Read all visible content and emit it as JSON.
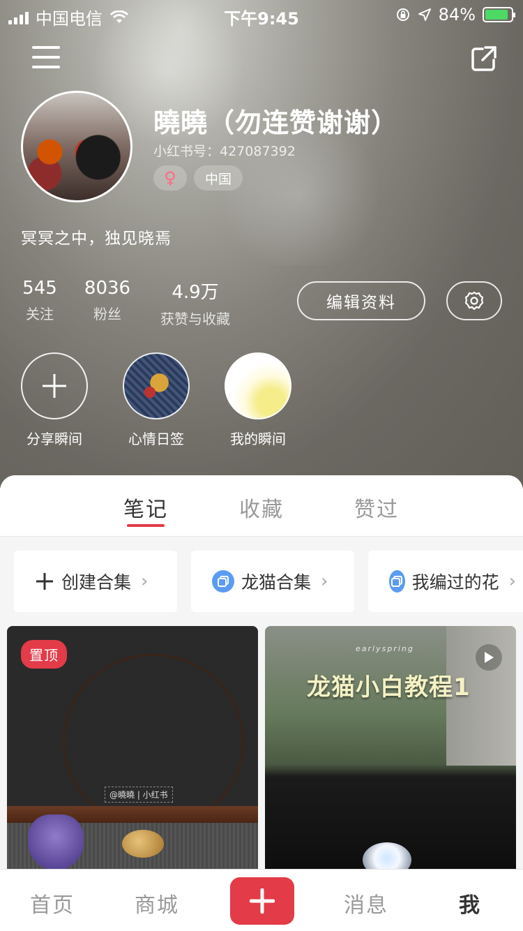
{
  "status_bar": {
    "carrier": "中国电信",
    "time": "下午9:45",
    "battery": "84%"
  },
  "profile": {
    "name": "曉曉（勿连赞谢谢）",
    "id_label": "小红书号：427087392",
    "gender_symbol": "♀",
    "region": "中国",
    "bio": "冥冥之中，独见晓焉"
  },
  "stats": [
    {
      "value": "545",
      "label": "关注"
    },
    {
      "value": "8036",
      "label": "粉丝"
    },
    {
      "value": "4.9万",
      "label": "获赞与收藏"
    }
  ],
  "buttons": {
    "edit_profile": "编辑资料"
  },
  "moments": [
    {
      "label": "分享瞬间"
    },
    {
      "label": "心情日签"
    },
    {
      "label": "我的瞬间"
    }
  ],
  "tabs": [
    {
      "label": "笔记"
    },
    {
      "label": "收藏"
    },
    {
      "label": "赞过"
    }
  ],
  "collections": [
    {
      "label": "创建合集",
      "icon": "plus-icon"
    },
    {
      "label": "龙猫合集",
      "icon": "collection-icon"
    },
    {
      "label": "我编过的花",
      "icon": "collection-icon"
    }
  ],
  "feed": [
    {
      "badge": "置顶",
      "watermark": "@曉曉 | 小红书"
    },
    {
      "title": "龙猫小白教程1",
      "subtitle": "earlyspring"
    }
  ],
  "bottom_nav": [
    {
      "label": "首页"
    },
    {
      "label": "商城"
    },
    {
      "label": "消息"
    },
    {
      "label": "我"
    }
  ],
  "colors": {
    "accent": "#e33b48",
    "collection_icon": "#5b9cf2"
  }
}
